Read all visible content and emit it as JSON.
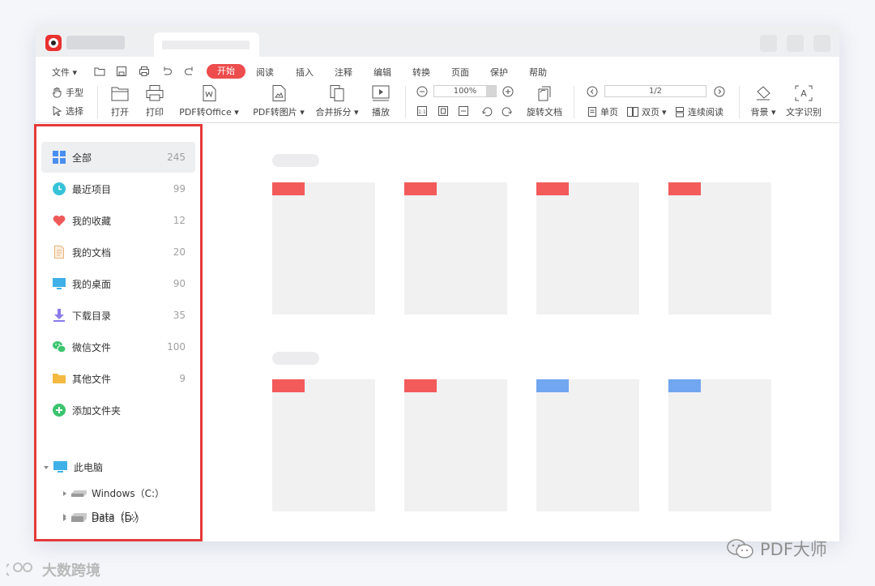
{
  "menu": {
    "file": "文件",
    "start": "开始",
    "items": [
      "阅读",
      "插入",
      "注释",
      "编辑",
      "转换",
      "页面",
      "保护",
      "帮助"
    ]
  },
  "toolbar": {
    "hand": "手型",
    "select": "选择",
    "open": "打开",
    "print": "打印",
    "pdf_to_office": "PDF转Office",
    "pdf_to_image": "PDF转图片",
    "merge_split": "合并拆分",
    "play": "播放",
    "zoom": "100%",
    "rotate_doc": "旋转文档",
    "page_indicator": "1/2",
    "single_page": "单页",
    "double_page": "双页",
    "continuous": "连续阅读",
    "background": "背景",
    "ocr": "文字识别"
  },
  "sidebar": {
    "items": [
      {
        "label": "全部",
        "count": "245",
        "icon": "grid-icon",
        "color": "#4a8ef0"
      },
      {
        "label": "最近项目",
        "count": "99",
        "icon": "clock-icon",
        "color": "#36c3d9"
      },
      {
        "label": "我的收藏",
        "count": "12",
        "icon": "heart-icon",
        "color": "#ee5a5a"
      },
      {
        "label": "我的文档",
        "count": "20",
        "icon": "document-icon",
        "color": "#e8b47a"
      },
      {
        "label": "我的桌面",
        "count": "90",
        "icon": "monitor-icon",
        "color": "#3fb0e8"
      },
      {
        "label": "下载目录",
        "count": "35",
        "icon": "download-icon",
        "color": "#8a7ce8"
      },
      {
        "label": "微信文件",
        "count": "100",
        "icon": "wechat-icon",
        "color": "#3cc46e"
      },
      {
        "label": "其他文件",
        "count": "9",
        "icon": "folder-icon",
        "color": "#f5b941"
      }
    ],
    "add_folder": "添加文件夹",
    "this_pc": "此电脑",
    "drives": [
      "Windows（C:）",
      "Data（D:）",
      "Data（E:）"
    ]
  },
  "colors": {
    "accent": "#ee4d4d",
    "tag_red": "#f35b5b",
    "tag_blue": "#71a6f0",
    "highlight": "#e53a3a"
  },
  "watermark": {
    "right": "PDF大师",
    "left": "大数跨境"
  }
}
